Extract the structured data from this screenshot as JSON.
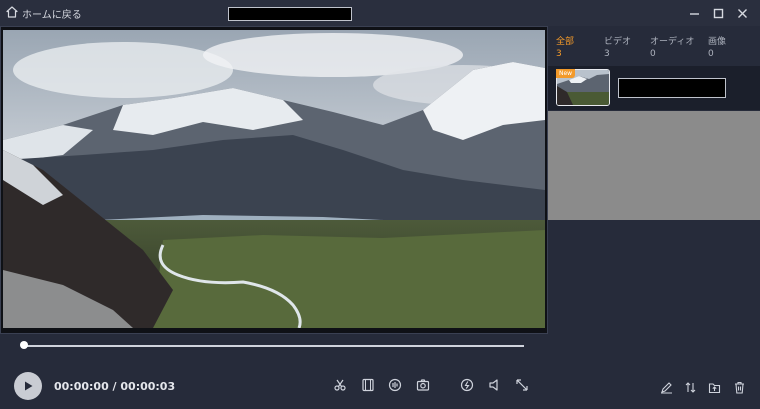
{
  "titlebar": {
    "back_label": "ホームに戻る"
  },
  "player": {
    "time_display": "00:00:00 / 00:00:03",
    "progress": 0
  },
  "media_panel": {
    "tabs": [
      {
        "label": "全部",
        "count": "3",
        "active": true
      },
      {
        "label": "ビデオ",
        "count": "3",
        "active": false
      },
      {
        "label": "オーディオ",
        "count": "0",
        "active": false
      },
      {
        "label": "画像",
        "count": "0",
        "active": false
      }
    ],
    "items": [
      {
        "badge": "New"
      }
    ]
  },
  "colors": {
    "accent": "#f39a2a",
    "background": "#262b3a",
    "titlebar": "#2a2f3e"
  },
  "icons": {
    "home": "home-icon",
    "minimize": "minimize-icon",
    "maximize": "maximize-icon",
    "close": "close-icon",
    "play": "play-icon",
    "cut": "scissors-icon",
    "film": "film-icon",
    "audio": "audio-icon",
    "snapshot": "camera-icon",
    "speed": "speed-icon",
    "volume": "volume-icon",
    "fullscreen": "fullscreen-icon",
    "rename": "rename-icon",
    "sort": "sort-icon",
    "export": "export-icon",
    "delete": "trash-icon"
  }
}
